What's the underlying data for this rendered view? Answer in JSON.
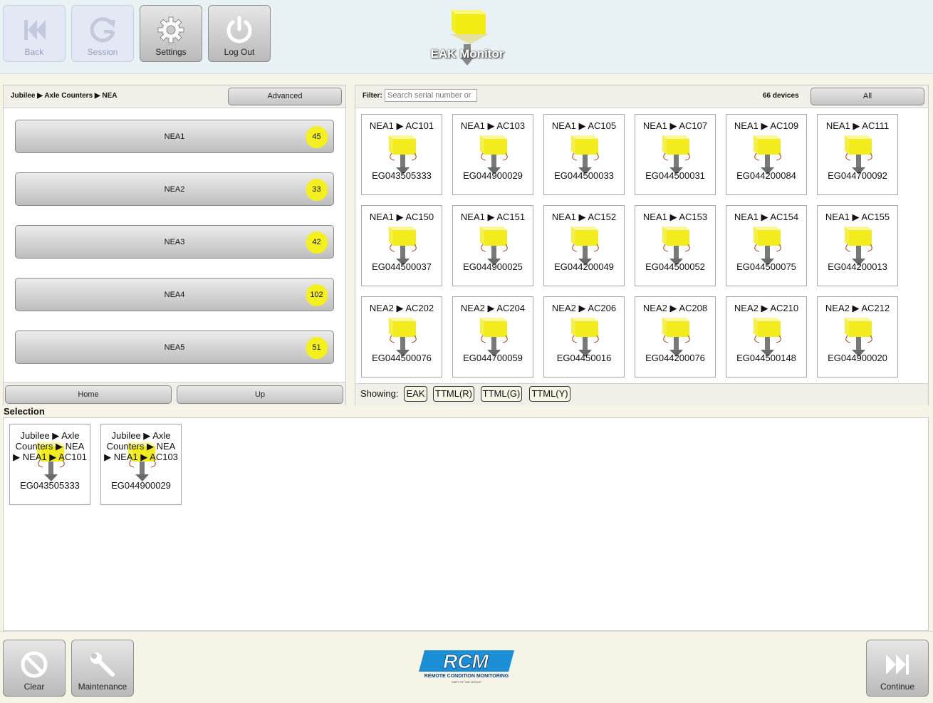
{
  "toolbar": {
    "back_label": "Back",
    "session_label": "Session",
    "settings_label": "Settings",
    "logout_label": "Log Out",
    "app_title": "EAK Monitor"
  },
  "left_panel": {
    "breadcrumb": "Jubilee ▶ Axle Counters ▶ NEA",
    "advanced_label": "Advanced",
    "items": [
      {
        "label": "NEA1",
        "count": "45"
      },
      {
        "label": "NEA2",
        "count": "33"
      },
      {
        "label": "NEA3",
        "count": "42"
      },
      {
        "label": "NEA4",
        "count": "102"
      },
      {
        "label": "NEA5",
        "count": "51"
      }
    ],
    "home_label": "Home",
    "up_label": "Up"
  },
  "right_panel": {
    "filter_label": "Filter:",
    "filter_placeholder": "Search serial number or",
    "device_count": "66 devices",
    "all_label": "All",
    "devices": [
      {
        "name": "NEA1 ▶ AC101",
        "serial": "EG043505333"
      },
      {
        "name": "NEA1 ▶ AC103",
        "serial": "EG044900029"
      },
      {
        "name": "NEA1 ▶ AC105",
        "serial": "EG044500033"
      },
      {
        "name": "NEA1 ▶ AC107",
        "serial": "EG044500031"
      },
      {
        "name": "NEA1 ▶ AC109",
        "serial": "EG044200084"
      },
      {
        "name": "NEA1 ▶ AC111",
        "serial": "EG044700092"
      },
      {
        "name": "NEA1 ▶ AC150",
        "serial": "EG044500037"
      },
      {
        "name": "NEA1 ▶ AC151",
        "serial": "EG044900025"
      },
      {
        "name": "NEA1 ▶ AC152",
        "serial": "EG044200049"
      },
      {
        "name": "NEA1 ▶ AC153",
        "serial": "EG044500052"
      },
      {
        "name": "NEA1 ▶ AC154",
        "serial": "EG044500075"
      },
      {
        "name": "NEA1 ▶ AC155",
        "serial": "EG044200013"
      },
      {
        "name": "NEA2 ▶ AC202",
        "serial": "EG044500076"
      },
      {
        "name": "NEA2 ▶ AC204",
        "serial": "EG044700059"
      },
      {
        "name": "NEA2 ▶ AC206",
        "serial": "EG04450016"
      },
      {
        "name": "NEA2 ▶ AC208",
        "serial": "EG044200076"
      },
      {
        "name": "NEA2 ▶ AC210",
        "serial": "EG044500148"
      },
      {
        "name": "NEA2 ▶ AC212",
        "serial": "EG044900020"
      }
    ],
    "showing_label": "Showing:",
    "showing_buttons": [
      "EAK",
      "TTML(R)",
      "TTML(G)",
      "TTML(Y)"
    ]
  },
  "selection": {
    "title": "Selection",
    "items": [
      {
        "path": "Jubilee ▶ Axle Counters ▶ NEA ▶ NEA1 ▶ AC101",
        "serial": "EG043505333"
      },
      {
        "path": "Jubilee ▶ Axle Counters ▶ NEA ▶ NEA1 ▶ AC103",
        "serial": "EG044900029"
      }
    ]
  },
  "bottombar": {
    "clear_label": "Clear",
    "maintenance_label": "Maintenance",
    "continue_label": "Continue",
    "logo_text": "RCM",
    "logo_subtitle": "REMOTE CONDITION MONITORING",
    "logo_tagline": "PART OF THE GROUP"
  },
  "colors": {
    "badge": "#f4ef1f",
    "device_yellow": "#f4ef4a",
    "logo_blue": "#1a8fd6"
  },
  "icons": [
    "back-icon",
    "session-icon",
    "settings-icon",
    "power-icon",
    "clear-icon",
    "wrench-icon",
    "continue-icon"
  ]
}
